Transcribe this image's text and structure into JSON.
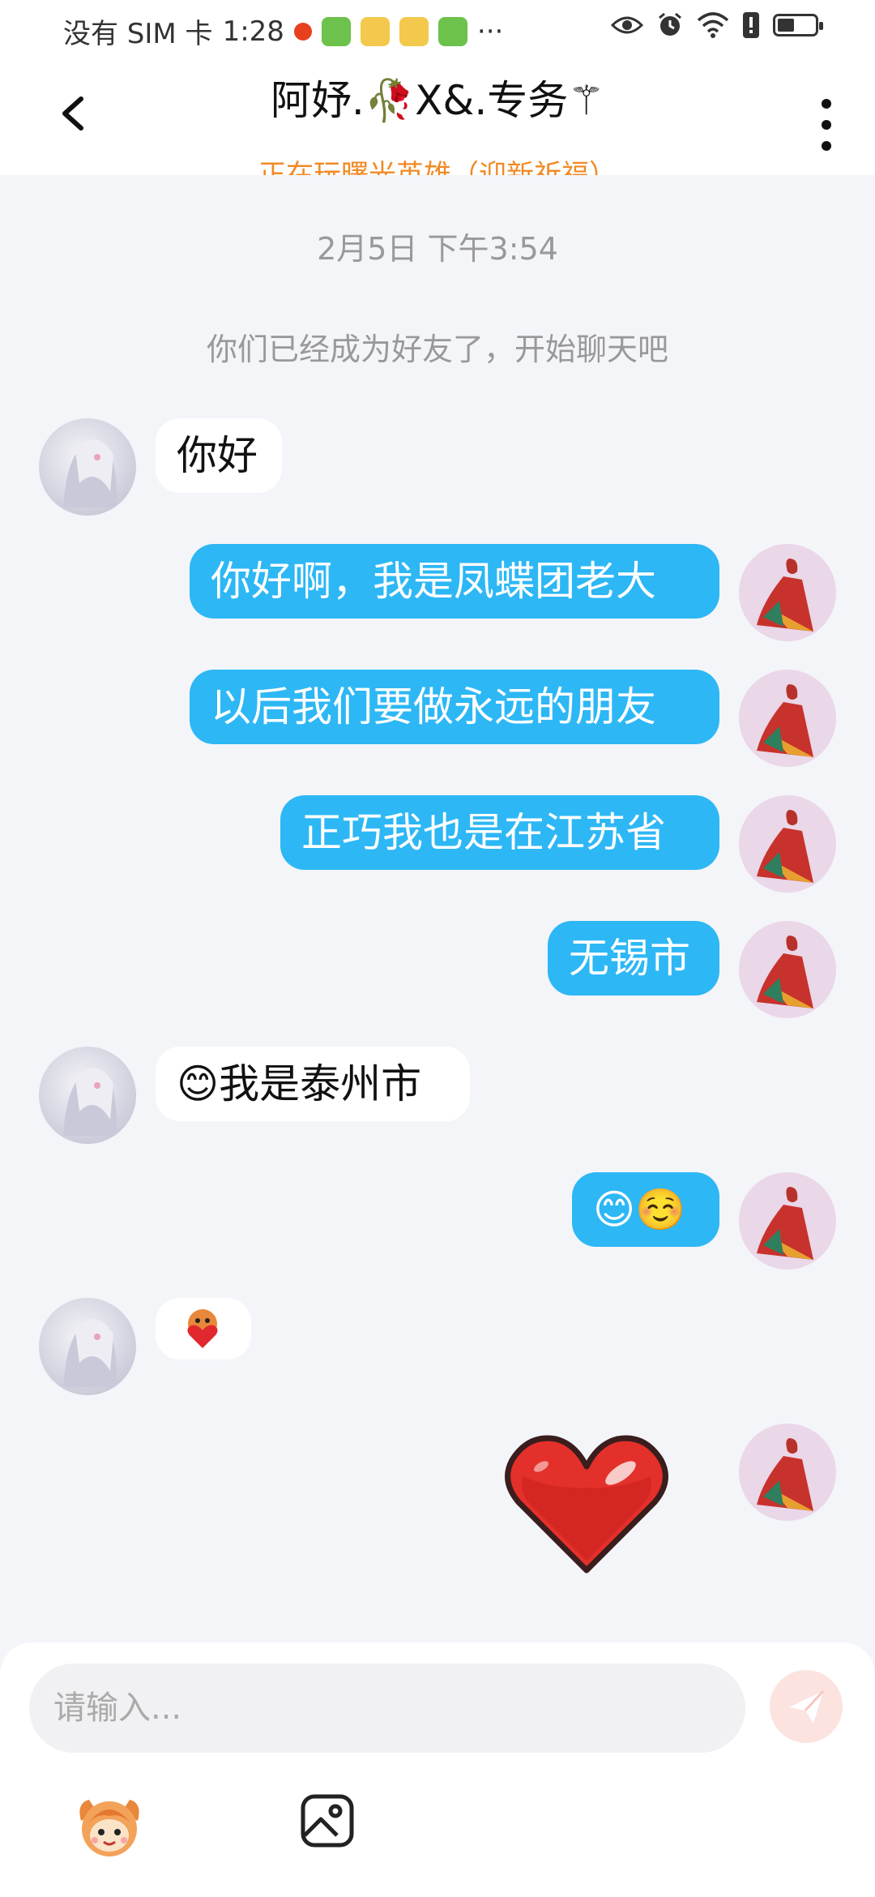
{
  "status_bar": {
    "carrier": "没有 SIM 卡",
    "time": "1:28",
    "more_indicator": "···",
    "battery_level": 0.45,
    "icons": [
      "notification-dot-icon",
      "app-icon",
      "app-icon",
      "app-icon",
      "app-icon",
      "eye-icon",
      "alarm-icon",
      "wifi-icon",
      "alert-icon",
      "battery-icon"
    ]
  },
  "header": {
    "title": "阿妤.🥀X&.专务⚚",
    "subtitle": "正在玩曙光英雄（迎新祈福）",
    "back_icon": "chevron-left-icon",
    "more_icon": "more-vertical-icon"
  },
  "chat": {
    "timestamp": "2月5日 下午3:54",
    "system_message": "你们已经成为好友了，开始聊天吧",
    "messages": [
      {
        "side": "in",
        "text": "你好"
      },
      {
        "side": "out",
        "text": "你好啊，我是凤蝶团老大"
      },
      {
        "side": "out",
        "text": "以后我们要做永远的朋友"
      },
      {
        "side": "out",
        "text": "正巧我也是在江苏省"
      },
      {
        "side": "out",
        "text": "无锡市"
      },
      {
        "side": "in",
        "text": "😊我是泰州市"
      },
      {
        "side": "out",
        "text": "😊☺️"
      },
      {
        "side": "in",
        "text": "",
        "sticker": "heart-sticker-small"
      },
      {
        "side": "out",
        "text": "",
        "sticker": "red-heart-sticker"
      }
    ]
  },
  "input": {
    "placeholder": "请输入...",
    "send_icon": "send-icon",
    "sticker_icon": "sticker-face-icon",
    "image_icon": "image-icon"
  },
  "colors": {
    "outgoing_bubble": "#2DB7F5",
    "incoming_bubble": "#FFFFFF",
    "subtitle": "#F08A24",
    "chat_background": "#F3F5F9"
  }
}
